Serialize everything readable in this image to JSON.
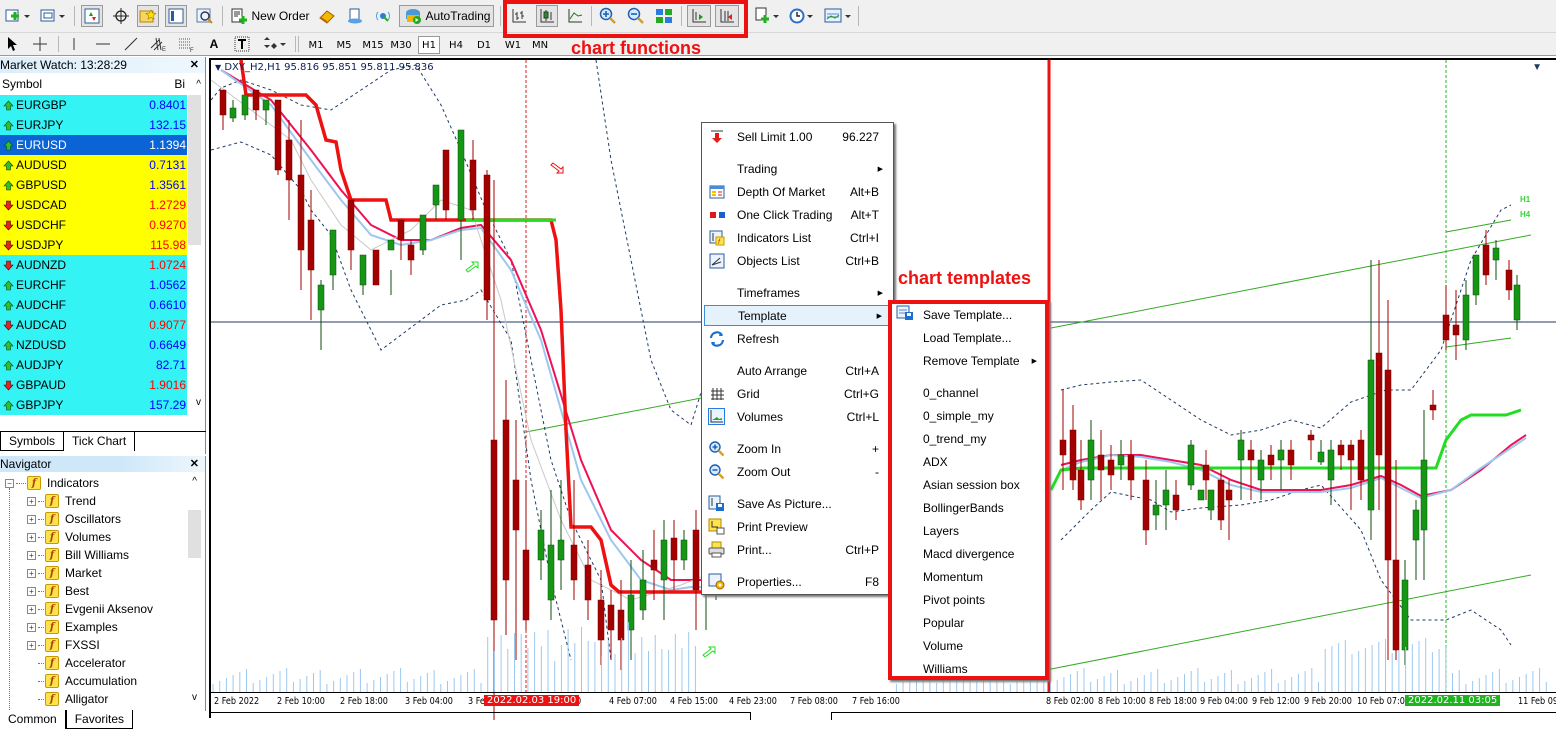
{
  "toolbar": {
    "new_order_label": "New Order",
    "autotrading_label": "AutoTrading",
    "timeframes": [
      "M1",
      "M5",
      "M15",
      "M30",
      "H1",
      "H4",
      "D1",
      "W1",
      "MN"
    ],
    "active_timeframe": "H1",
    "icons": [
      "new-chart-icon",
      "profiles-icon",
      "market-watch-icon",
      "data-window-icon",
      "navigator-icon",
      "terminal-icon",
      "strategy-tester-icon",
      "metaeditor-icon",
      "signals-icon",
      "vps-icon",
      "bar-chart-icon",
      "candlestick-icon",
      "line-chart-icon",
      "zoom-in-icon",
      "zoom-out-icon",
      "tile-windows-icon",
      "autoscroll-icon",
      "chart-shift-icon",
      "indicators-icon",
      "periods-icon",
      "templates-icon"
    ]
  },
  "annotations": {
    "chart_functions": "chart functions",
    "chart_templates": "chart templates"
  },
  "market_watch": {
    "title": "Market Watch: 13:28:29",
    "col_symbol": "Symbol",
    "col_bid": "Bi",
    "rows": [
      {
        "symbol": "EURGBP",
        "bid": "0.8401",
        "dir": "up",
        "bg": "#33f3f5",
        "bid_color": "#0000ff"
      },
      {
        "symbol": "EURJPY",
        "bid": "132.15",
        "dir": "up",
        "bg": "#33f3f5",
        "bid_color": "#0000ff"
      },
      {
        "symbol": "EURUSD",
        "bid": "1.1394",
        "dir": "up",
        "bg": "#0a64d6",
        "bid_color": "#ffffff",
        "selected": true
      },
      {
        "symbol": "AUDUSD",
        "bid": "0.7131",
        "dir": "up",
        "bg": "#ffff00",
        "bid_color": "#0000ff"
      },
      {
        "symbol": "GBPUSD",
        "bid": "1.3561",
        "dir": "up",
        "bg": "#ffff00",
        "bid_color": "#0000ff"
      },
      {
        "symbol": "USDCAD",
        "bid": "1.2729",
        "dir": "down",
        "bg": "#ffff00",
        "bid_color": "#ff0000"
      },
      {
        "symbol": "USDCHF",
        "bid": "0.9270",
        "dir": "down",
        "bg": "#ffff00",
        "bid_color": "#ff0000"
      },
      {
        "symbol": "USDJPY",
        "bid": "115.98",
        "dir": "down",
        "bg": "#ffff00",
        "bid_color": "#ff0000"
      },
      {
        "symbol": "AUDNZD",
        "bid": "1.0724",
        "dir": "down",
        "bg": "#33f3f5",
        "bid_color": "#ff0000"
      },
      {
        "symbol": "EURCHF",
        "bid": "1.0562",
        "dir": "up",
        "bg": "#33f3f5",
        "bid_color": "#0000ff"
      },
      {
        "symbol": "AUDCHF",
        "bid": "0.6610",
        "dir": "up",
        "bg": "#33f3f5",
        "bid_color": "#0000ff"
      },
      {
        "symbol": "AUDCAD",
        "bid": "0.9077",
        "dir": "down",
        "bg": "#33f3f5",
        "bid_color": "#ff0000"
      },
      {
        "symbol": "NZDUSD",
        "bid": "0.6649",
        "dir": "up",
        "bg": "#33f3f5",
        "bid_color": "#0000ff"
      },
      {
        "symbol": "AUDJPY",
        "bid": "82.71",
        "dir": "up",
        "bg": "#33f3f5",
        "bid_color": "#0000ff"
      },
      {
        "symbol": "GBPAUD",
        "bid": "1.9016",
        "dir": "down",
        "bg": "#33f3f5",
        "bid_color": "#ff0000"
      },
      {
        "symbol": "GBPJPY",
        "bid": "157.29",
        "dir": "up",
        "bg": "#33f3f5",
        "bid_color": "#0000ff"
      }
    ],
    "tabs": [
      "Symbols",
      "Tick Chart"
    ]
  },
  "navigator": {
    "title": "Navigator",
    "root": "Indicators",
    "items": [
      {
        "label": "Trend",
        "expandable": true,
        "custom": false
      },
      {
        "label": "Oscillators",
        "expandable": true,
        "custom": false
      },
      {
        "label": "Volumes",
        "expandable": true,
        "custom": false
      },
      {
        "label": "Bill Williams",
        "expandable": true,
        "custom": false
      },
      {
        "label": "Market",
        "expandable": true,
        "custom": false
      },
      {
        "label": "Best",
        "expandable": true,
        "custom": true
      },
      {
        "label": "Evgenii Aksenov",
        "expandable": true,
        "custom": true
      },
      {
        "label": "Examples",
        "expandable": true,
        "custom": true
      },
      {
        "label": "FXSSI",
        "expandable": true,
        "custom": true
      },
      {
        "label": "Accelerator",
        "expandable": false,
        "custom": true
      },
      {
        "label": "Accumulation",
        "expandable": false,
        "custom": true
      },
      {
        "label": "Alligator",
        "expandable": false,
        "custom": true
      }
    ],
    "tabs": [
      "Common",
      "Favorites"
    ]
  },
  "chart": {
    "title": "DXY_H2,H1  95.816 95.851 95.811 95.836",
    "x_labels": [
      "2 Feb 2022",
      "2 Feb 10:00",
      "2 Feb 18:00",
      "3 Feb 04:00",
      "3 Fe",
      "0:00",
      "4 Feb 07:00",
      "4 Feb 15:00",
      "4 Feb 23:00",
      "7 Feb 08:00",
      "7 Feb 16:00",
      "8 Feb 02:00",
      "8 Feb 10:00",
      "8 Feb 18:00",
      "9 Feb 04:00",
      "9 Feb 12:00",
      "9 Feb 20:00",
      "10 Feb 07:00",
      "10 Feb 15",
      "11 Feb 09:00"
    ],
    "highlight_red": "2022.02.03 19:00",
    "highlight_green": "2022.02.11 03:05",
    "labels_right": [
      "H1",
      "H4"
    ]
  },
  "context_menu": {
    "items": [
      {
        "label": "Sell Limit 1.00",
        "shortcut": "96.227",
        "icon": "sell-arrow-icon"
      },
      {
        "label": "Trading",
        "submenu": true
      },
      {
        "label": "Depth Of Market",
        "shortcut": "Alt+B",
        "icon": "depth-of-market-icon"
      },
      {
        "label": "One Click Trading",
        "shortcut": "Alt+T",
        "icon": "one-click-trading-icon"
      },
      {
        "label": "Indicators List",
        "shortcut": "Ctrl+I",
        "icon": "indicators-list-icon"
      },
      {
        "label": "Objects List",
        "shortcut": "Ctrl+B",
        "icon": "objects-list-icon"
      },
      {
        "label": "Timeframes",
        "submenu": true
      },
      {
        "label": "Template",
        "submenu": true,
        "highlighted": true
      },
      {
        "label": "Refresh",
        "icon": "refresh-icon"
      },
      {
        "label": "Auto Arrange",
        "shortcut": "Ctrl+A"
      },
      {
        "label": "Grid",
        "shortcut": "Ctrl+G",
        "icon": "grid-icon"
      },
      {
        "label": "Volumes",
        "shortcut": "Ctrl+L",
        "icon": "volumes-icon"
      },
      {
        "label": "Zoom In",
        "shortcut": "+",
        "icon": "zoom-in-icon"
      },
      {
        "label": "Zoom Out",
        "shortcut": "-",
        "icon": "zoom-out-icon"
      },
      {
        "label": "Save As Picture...",
        "icon": "save-picture-icon"
      },
      {
        "label": "Print Preview",
        "icon": "print-preview-icon"
      },
      {
        "label": "Print...",
        "shortcut": "Ctrl+P",
        "icon": "print-icon"
      },
      {
        "label": "Properties...",
        "shortcut": "F8",
        "icon": "properties-icon"
      }
    ]
  },
  "template_menu": {
    "items": [
      {
        "label": "Save Template...",
        "icon": "save-template-icon"
      },
      {
        "label": "Load Template..."
      },
      {
        "label": "Remove Template",
        "submenu": true
      },
      {
        "label": "0_channel"
      },
      {
        "label": "0_simple_my"
      },
      {
        "label": "0_trend_my"
      },
      {
        "label": "ADX"
      },
      {
        "label": "Asian session box"
      },
      {
        "label": "BollingerBands"
      },
      {
        "label": "Layers"
      },
      {
        "label": "Macd divergence"
      },
      {
        "label": "Momentum"
      },
      {
        "label": "Pivot points"
      },
      {
        "label": "Popular"
      },
      {
        "label": "Volume"
      },
      {
        "label": "Williams"
      }
    ]
  }
}
